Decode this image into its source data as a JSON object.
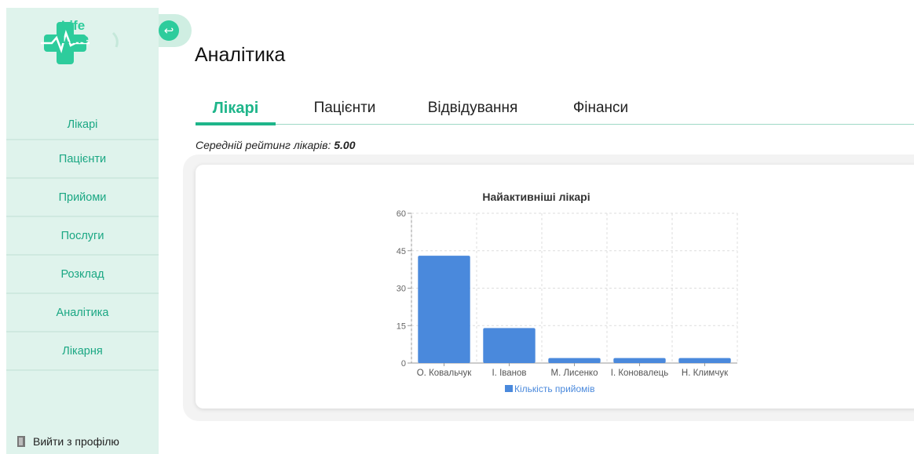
{
  "logo": {
    "line1": "Life",
    "line2": "Line"
  },
  "sidebar": {
    "items": [
      {
        "label": "Лікарі"
      },
      {
        "label": "Пацієнти"
      },
      {
        "label": "Прийоми"
      },
      {
        "label": "Послуги"
      },
      {
        "label": "Розклад"
      },
      {
        "label": "Аналітика"
      },
      {
        "label": "Лікарня"
      }
    ],
    "logout_label": "Вийти з профілю"
  },
  "page": {
    "title": "Аналітика"
  },
  "tabs": [
    {
      "label": "Лікарі",
      "active": true
    },
    {
      "label": "Пацієнти"
    },
    {
      "label": "Відвідування"
    },
    {
      "label": "Фінанси"
    }
  ],
  "rating": {
    "label": "Середній рейтинг лікарів:",
    "value": "5.00"
  },
  "colors": {
    "accent": "#1eb58a",
    "sidebar_bg": "#dff3ec",
    "bar": "#4a89dc"
  },
  "chart_data": {
    "type": "bar",
    "title": "Найактивніші лікарі",
    "categories": [
      "О. Ковальчук",
      "І. Іванов",
      "М. Лисенко",
      "І. Коновалець",
      "Н. Климчук"
    ],
    "series": [
      {
        "name": "Кількість прийомів",
        "values": [
          43,
          14,
          2,
          2,
          2
        ]
      }
    ],
    "ylim": [
      0,
      60
    ],
    "yticks": [
      0,
      15,
      30,
      45,
      60
    ],
    "grid": true,
    "legend": "bottom"
  }
}
